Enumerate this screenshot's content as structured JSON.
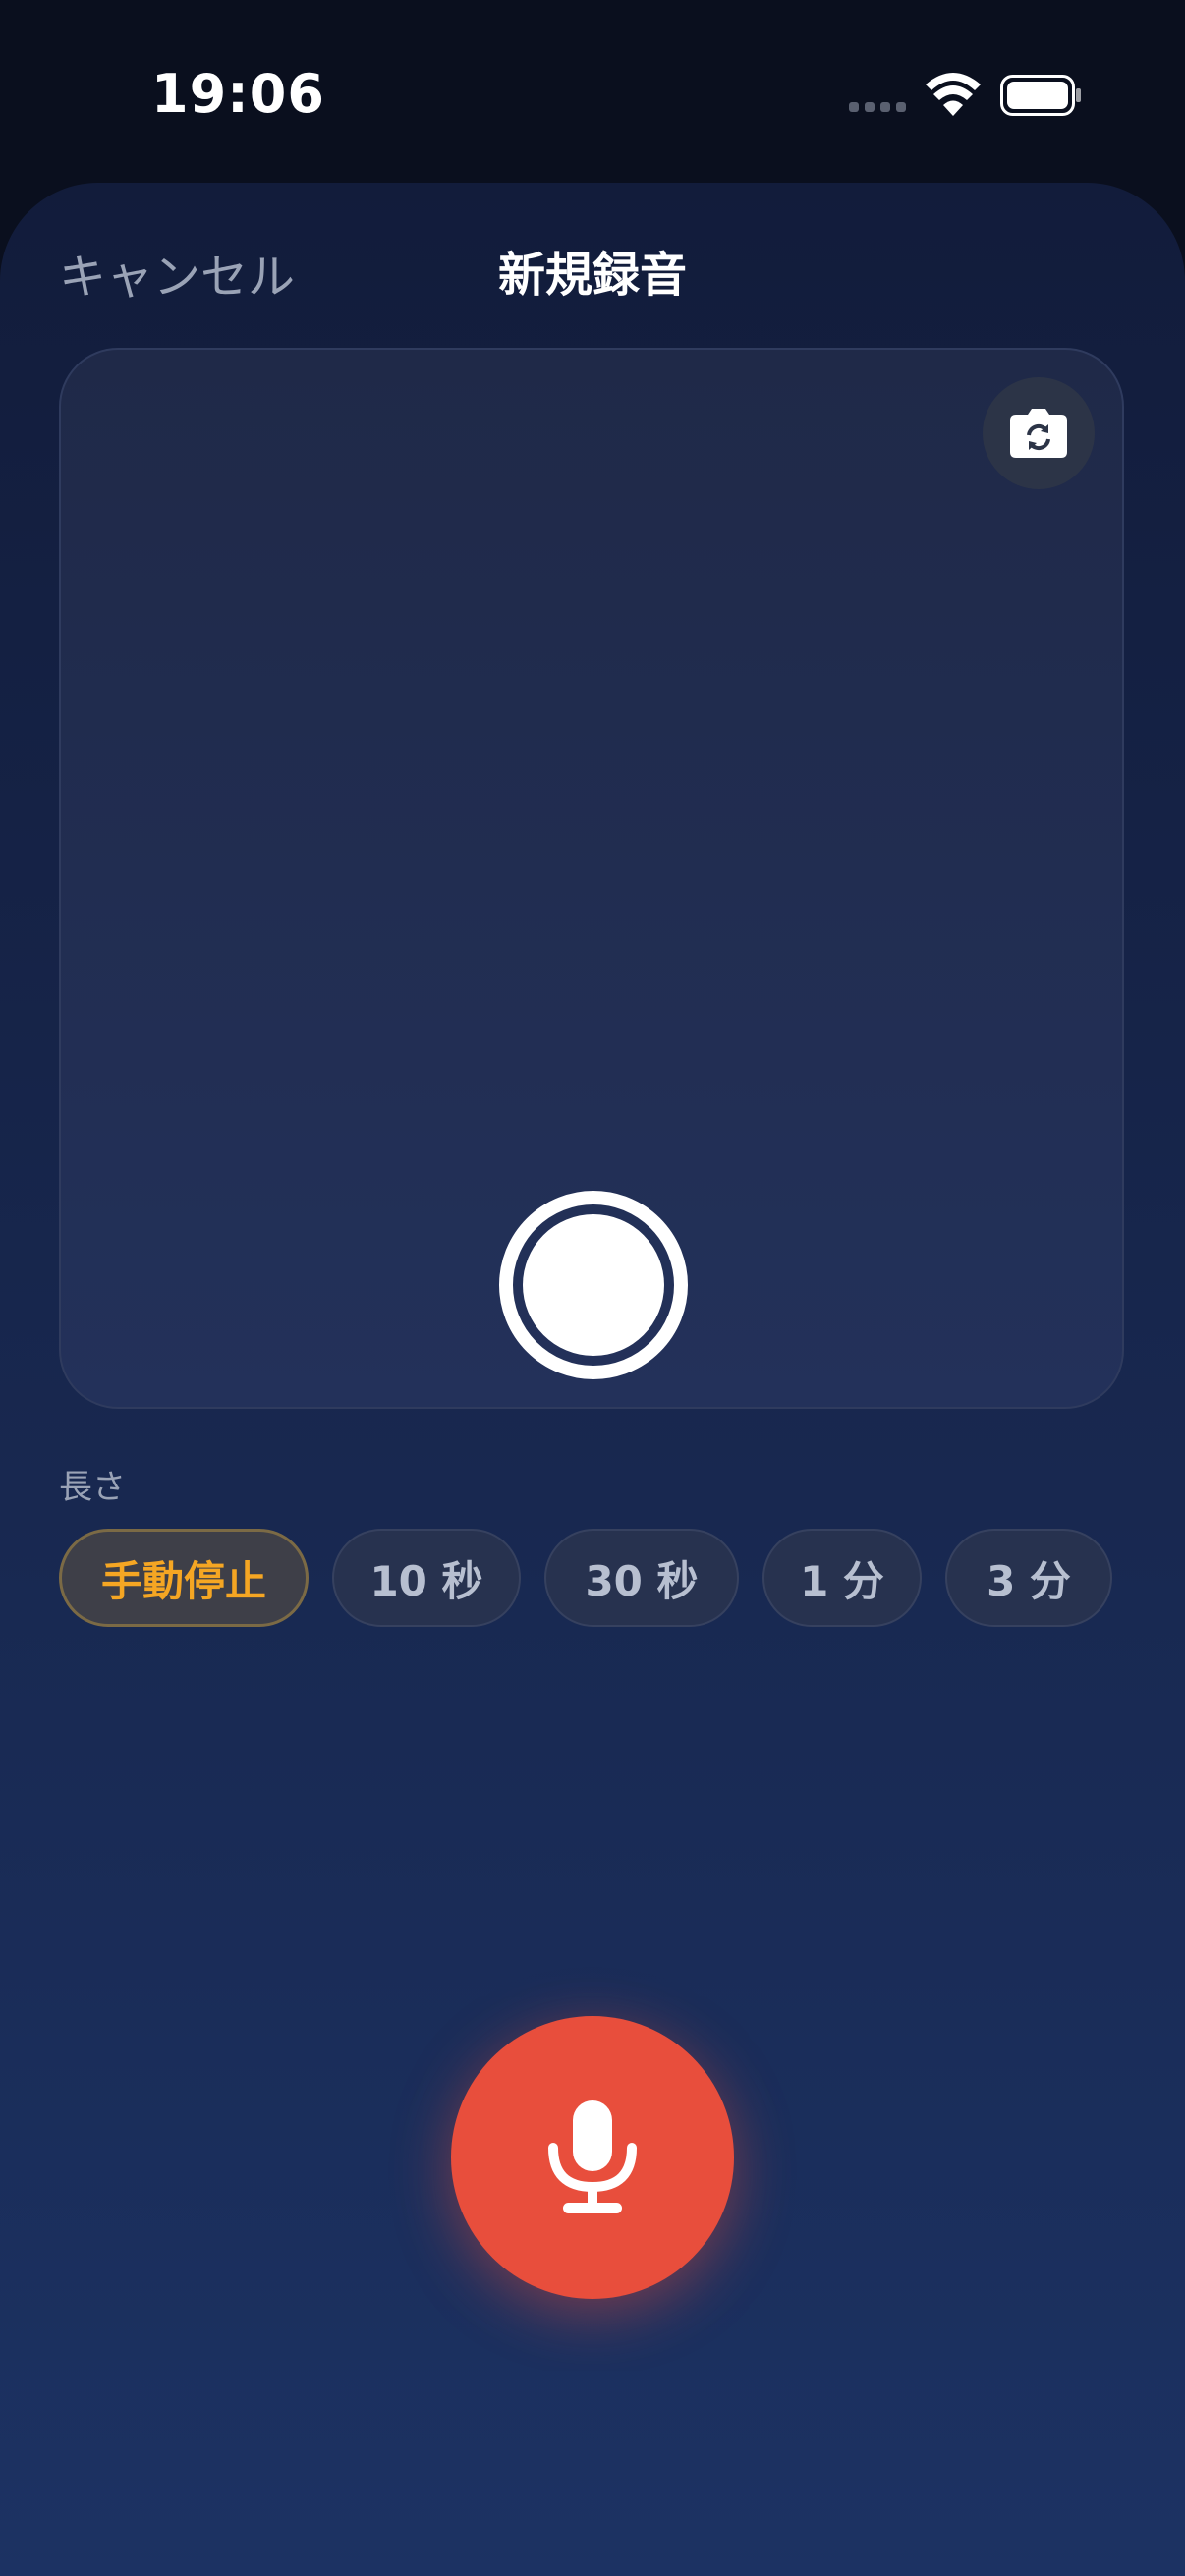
{
  "status_bar": {
    "time": "19:06"
  },
  "header": {
    "cancel_label": "キャンセル",
    "title": "新規録音"
  },
  "preview": {
    "flip_icon": "camera-rotate-icon",
    "shutter_icon": "shutter-icon"
  },
  "duration": {
    "label": "長さ",
    "options": [
      {
        "label": "手動停止",
        "selected": true
      },
      {
        "label": "10 秒",
        "selected": false
      },
      {
        "label": "30 秒",
        "selected": false
      },
      {
        "label": "1 分",
        "selected": false
      },
      {
        "label": "3 分",
        "selected": false
      }
    ]
  },
  "record": {
    "icon": "microphone-icon"
  },
  "colors": {
    "accent": "#f5a623",
    "record": "#e84e3c"
  }
}
